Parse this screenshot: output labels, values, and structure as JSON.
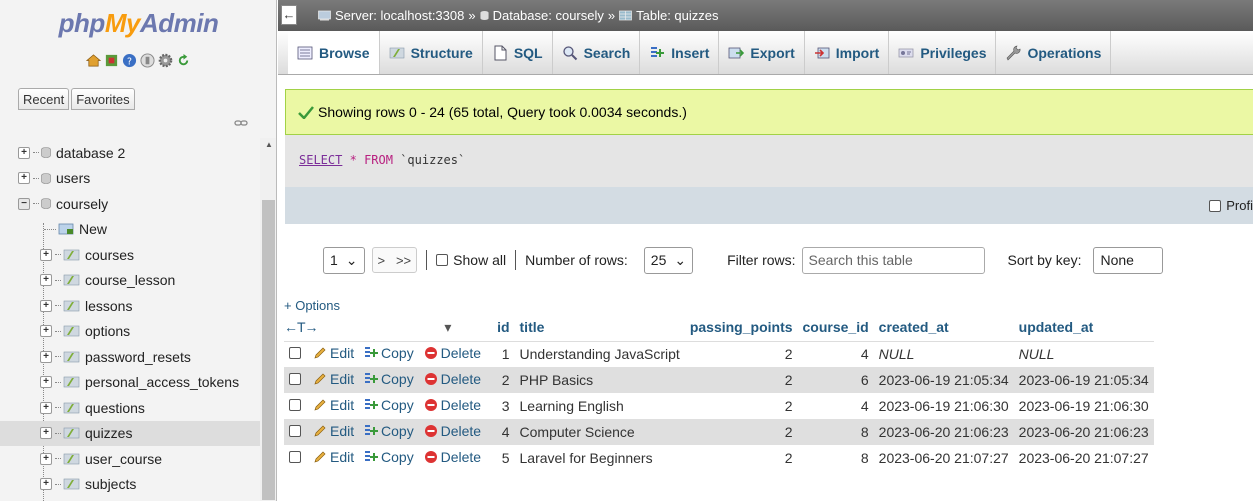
{
  "sidebar": {
    "logo": {
      "part1": "php",
      "part2": "My",
      "part3": "Admin"
    },
    "quick_icons": [
      "home-icon",
      "exit-icon",
      "help-icon",
      "docs-icon",
      "settings-icon",
      "reload-icon"
    ],
    "tabs": [
      "Recent",
      "Favorites"
    ],
    "tree": [
      {
        "label": "database 2",
        "type": "db",
        "level": 0,
        "expanded": false
      },
      {
        "label": "users",
        "type": "db",
        "level": 0,
        "expanded": false
      },
      {
        "label": "coursely",
        "type": "db",
        "level": 0,
        "expanded": true
      },
      {
        "label": "New",
        "type": "new",
        "level": 1
      },
      {
        "label": "courses",
        "type": "table",
        "level": 1
      },
      {
        "label": "course_lesson",
        "type": "table",
        "level": 1
      },
      {
        "label": "lessons",
        "type": "table",
        "level": 1
      },
      {
        "label": "options",
        "type": "table",
        "level": 1
      },
      {
        "label": "password_resets",
        "type": "table",
        "level": 1
      },
      {
        "label": "personal_access_tokens",
        "type": "table",
        "level": 1
      },
      {
        "label": "questions",
        "type": "table",
        "level": 1
      },
      {
        "label": "quizzes",
        "type": "table",
        "level": 1,
        "selected": true
      },
      {
        "label": "user_course",
        "type": "table",
        "level": 1
      },
      {
        "label": "subjects",
        "type": "table",
        "level": 1
      }
    ]
  },
  "breadcrumb": {
    "server": "Server: localhost:3308",
    "sep": "»",
    "database": "Database: coursely",
    "table": "Table: quizzes"
  },
  "menu": [
    {
      "label": "Browse",
      "icon": "browse-icon",
      "active": true
    },
    {
      "label": "Structure",
      "icon": "structure-icon"
    },
    {
      "label": "SQL",
      "icon": "sql-icon"
    },
    {
      "label": "Search",
      "icon": "search-icon"
    },
    {
      "label": "Insert",
      "icon": "insert-icon"
    },
    {
      "label": "Export",
      "icon": "export-icon"
    },
    {
      "label": "Import",
      "icon": "import-icon"
    },
    {
      "label": "Privileges",
      "icon": "privileges-icon"
    },
    {
      "label": "Operations",
      "icon": "operations-icon"
    }
  ],
  "message": "Showing rows 0 - 24 (65 total, Query took 0.0034 seconds.)",
  "query": {
    "kw": "SELECT",
    "op": "*",
    "from": "FROM",
    "table": "`quizzes`"
  },
  "profiling_label": "Profi",
  "navigation": {
    "page": "1",
    "next": ">",
    "last": ">>",
    "show_all": "Show all",
    "rows_label": "Number of rows:",
    "rows_value": "25",
    "filter_label": "Filter rows:",
    "filter_placeholder": "Search this table",
    "sort_label": "Sort by key:",
    "sort_value": "None"
  },
  "options_label": "+ Options",
  "table": {
    "arrows": "←T→",
    "columns": [
      "id",
      "title",
      "passing_points",
      "course_id",
      "created_at",
      "updated_at"
    ],
    "actions": {
      "edit": "Edit",
      "copy": "Copy",
      "delete": "Delete"
    },
    "rows": [
      {
        "id": "1",
        "title": "Understanding JavaScript",
        "passing_points": "2",
        "course_id": "4",
        "created_at": "NULL",
        "updated_at": "NULL"
      },
      {
        "id": "2",
        "title": "PHP Basics",
        "passing_points": "2",
        "course_id": "6",
        "created_at": "2023-06-19 21:05:34",
        "updated_at": "2023-06-19 21:05:34"
      },
      {
        "id": "3",
        "title": "Learning English",
        "passing_points": "2",
        "course_id": "4",
        "created_at": "2023-06-19 21:06:30",
        "updated_at": "2023-06-19 21:06:30"
      },
      {
        "id": "4",
        "title": "Computer Science",
        "passing_points": "2",
        "course_id": "8",
        "created_at": "2023-06-20 21:06:23",
        "updated_at": "2023-06-20 21:06:23"
      },
      {
        "id": "5",
        "title": "Laravel for Beginners",
        "passing_points": "2",
        "course_id": "8",
        "created_at": "2023-06-20 21:07:27",
        "updated_at": "2023-06-20 21:07:27"
      }
    ]
  }
}
